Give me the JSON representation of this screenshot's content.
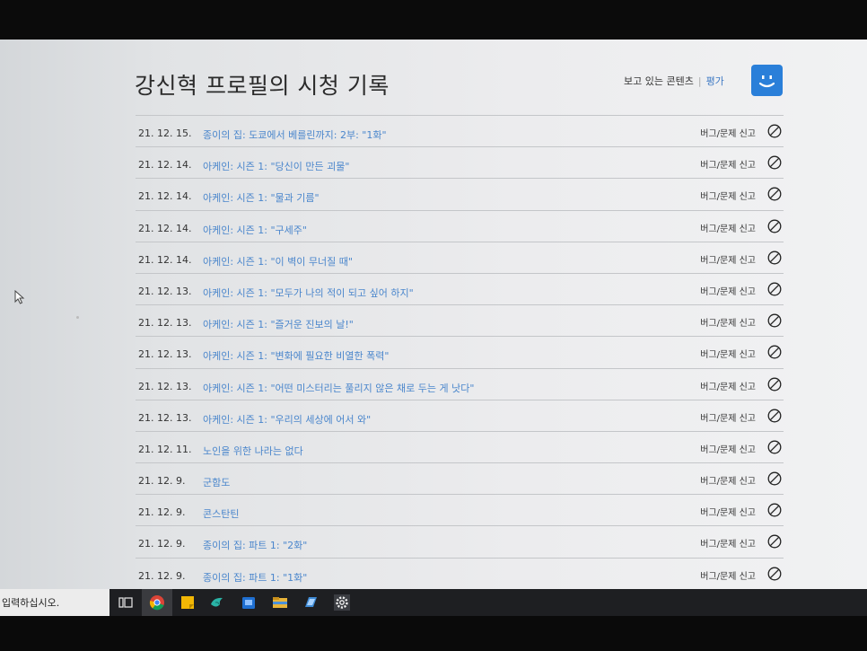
{
  "page": {
    "title": "강신혁 프로필의 시청 기록",
    "links": {
      "watching": "보고 있는 콘텐츠",
      "separator": "|",
      "rating": "평가"
    }
  },
  "report_label": "버그/문제 신고",
  "history": [
    {
      "date": "21. 12. 15.",
      "title": "종이의 집: 도쿄에서 베를린까지: 2부: \"1화\""
    },
    {
      "date": "21. 12. 14.",
      "title": "아케인: 시즌 1: \"당신이 만든 괴물\""
    },
    {
      "date": "21. 12. 14.",
      "title": "아케인: 시즌 1: \"물과 기름\""
    },
    {
      "date": "21. 12. 14.",
      "title": "아케인: 시즌 1: \"구세주\""
    },
    {
      "date": "21. 12. 14.",
      "title": "아케인: 시즌 1: \"이 벽이 무너질 때\""
    },
    {
      "date": "21. 12. 13.",
      "title": "아케인: 시즌 1: \"모두가 나의 적이 되고 싶어 하지\""
    },
    {
      "date": "21. 12. 13.",
      "title": "아케인: 시즌 1: \"즐거운 진보의 날!\""
    },
    {
      "date": "21. 12. 13.",
      "title": "아케인: 시즌 1: \"변화에 필요한 비열한 폭력\""
    },
    {
      "date": "21. 12. 13.",
      "title": "아케인: 시즌 1: \"어떤 미스터리는 풀리지 않은 채로 두는 게 낫다\""
    },
    {
      "date": "21. 12. 13.",
      "title": "아케인: 시즌 1: \"우리의 세상에 어서 와\""
    },
    {
      "date": "21. 12. 11.",
      "title": "노인을 위한 나라는 없다"
    },
    {
      "date": "21. 12. 9.",
      "title": "군함도"
    },
    {
      "date": "21. 12. 9.",
      "title": "콘스탄틴"
    },
    {
      "date": "21. 12. 9.",
      "title": "종이의 집: 파트 1: \"2화\""
    },
    {
      "date": "21. 12. 9.",
      "title": "종이의 집: 파트 1: \"1화\""
    }
  ],
  "taskbar": {
    "search_placeholder": "입력하십시오.",
    "icons": [
      "task-view-icon",
      "chrome-icon",
      "sticky-notes-icon",
      "bird-app-icon",
      "store-icon",
      "file-explorer-icon",
      "document-icon",
      "settings-icon"
    ]
  },
  "colors": {
    "accent_blue": "#3d79c4",
    "link_blue": "#4a86cc",
    "avatar_blue": "#2a7fd9"
  }
}
